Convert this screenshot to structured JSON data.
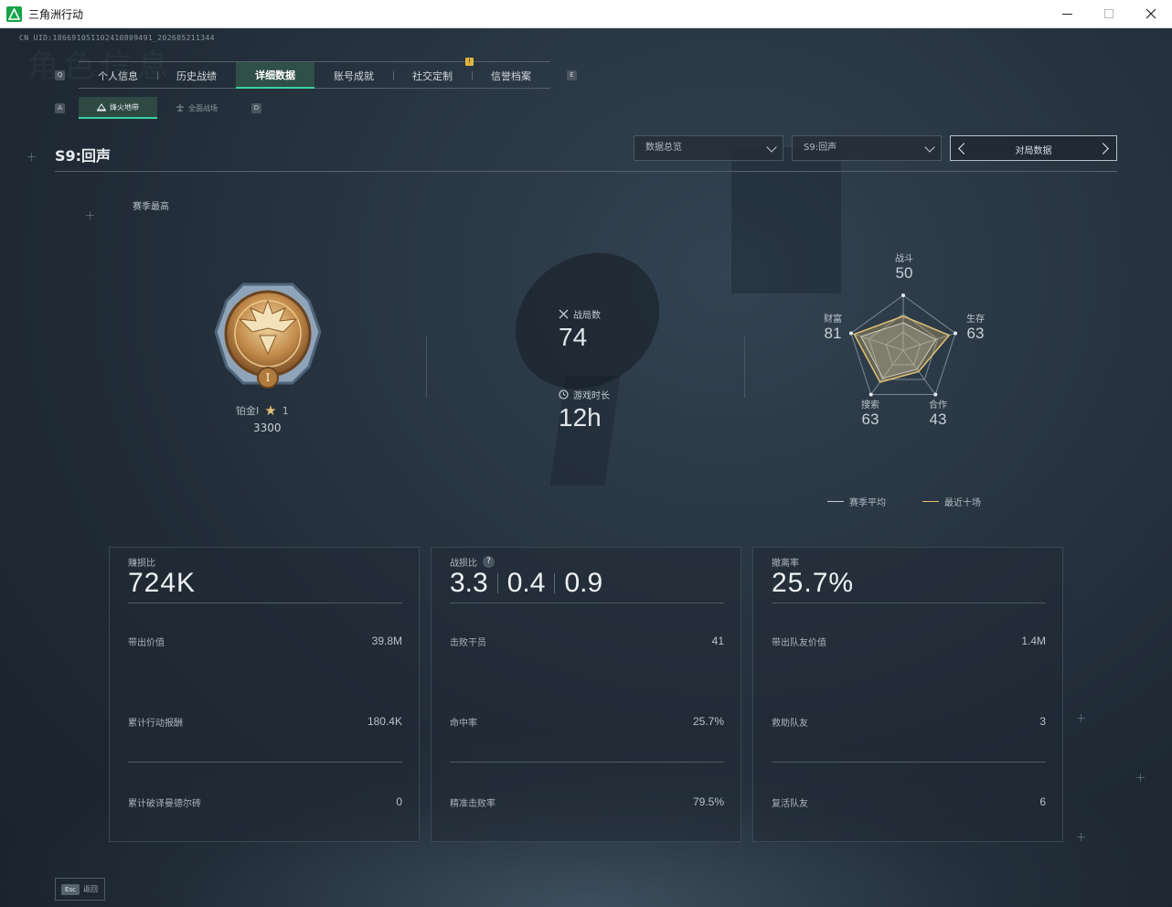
{
  "window": {
    "title": "三角洲行动"
  },
  "header": {
    "uid": "CN UID:186691051102410809491_202605211344",
    "bg_text": "角色信息",
    "key_left": "Q",
    "key_right": "E",
    "sub_key_left": "A",
    "sub_key_right": "D",
    "badge": "!"
  },
  "main_tabs": [
    {
      "label": "个人信息"
    },
    {
      "label": "历史战绩"
    },
    {
      "label": "详细数据"
    },
    {
      "label": "账号成就"
    },
    {
      "label": "社交定制"
    },
    {
      "label": "信誉档案"
    }
  ],
  "sub_tabs": [
    {
      "label": "烽火地带"
    },
    {
      "label": "全面战场"
    }
  ],
  "season": {
    "title": "S9:回声"
  },
  "filters": {
    "overview": "数据总览",
    "season": "S9:回声",
    "pager_label": "对局数据"
  },
  "rank": {
    "section_label": "赛季最高",
    "name": "铂金I",
    "stars": "1",
    "score": "3300",
    "emblem_numeral": "I"
  },
  "summary": {
    "matches_label": "战局数",
    "matches_value": "74",
    "playtime_label": "游戏时长",
    "playtime_value": "12h"
  },
  "radar": {
    "axes": [
      {
        "name": "战斗",
        "value": 50
      },
      {
        "name": "生存",
        "value": 63
      },
      {
        "name": "合作",
        "value": 43
      },
      {
        "name": "搜索",
        "value": 63
      },
      {
        "name": "财富",
        "value": 81
      }
    ],
    "recent": [
      62,
      88,
      48,
      72,
      94
    ],
    "legend": [
      {
        "label": "赛季平均",
        "color": "#c9d1d8"
      },
      {
        "label": "最近十场",
        "color": "#e2c173"
      }
    ]
  },
  "cards": [
    {
      "label": "赚损比",
      "value": "724K",
      "rows": [
        {
          "label": "带出价值",
          "value": "39.8M"
        },
        {
          "label": "累计行动报酬",
          "value": "180.4K"
        },
        {
          "label": "累计破译曼德尔砖",
          "value": "0"
        }
      ]
    },
    {
      "label": "战损比",
      "help": "?",
      "values": [
        "3.3",
        "0.4",
        "0.9"
      ],
      "rows": [
        {
          "label": "击败干员",
          "value": "41"
        },
        {
          "label": "命中率",
          "value": "25.7%"
        },
        {
          "label": "精准击败率",
          "value": "79.5%"
        }
      ]
    },
    {
      "label": "撤离率",
      "value": "25.7%",
      "rows": [
        {
          "label": "带出队友价值",
          "value": "1.4M"
        },
        {
          "label": "救助队友",
          "value": "3"
        },
        {
          "label": "复活队友",
          "value": "6"
        }
      ]
    }
  ],
  "footer": {
    "esc_key": "Esc",
    "esc_label": "返回"
  },
  "colors": {
    "accent": "#38d39f",
    "gold": "#e2c173"
  }
}
